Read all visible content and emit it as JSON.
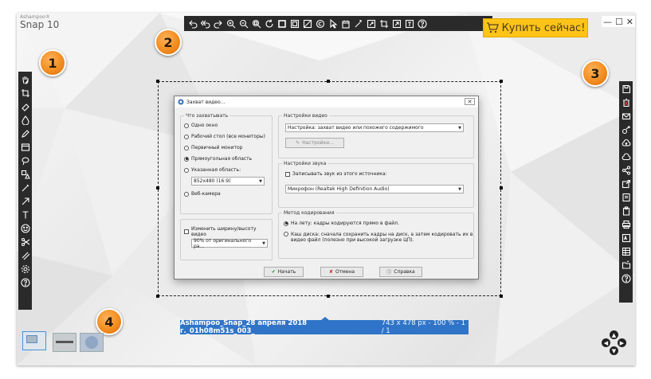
{
  "app": {
    "brand_small": "Ashampoo®",
    "brand_name": "Snap 10"
  },
  "top_toolbar": {
    "icons": [
      "undo-icon",
      "undo-all-icon",
      "redo-icon",
      "zoom-in-icon",
      "zoom-out-icon",
      "zoom-fit-icon",
      "rotate-icon",
      "crop-frame-icon",
      "border-icon",
      "color-icon",
      "copyright-icon",
      "pointer-icon",
      "calendar-icon",
      "magic-icon",
      "resize-icon",
      "crop-icon",
      "expand-icon",
      "text-frame-icon",
      "help-icon"
    ]
  },
  "buy_button": {
    "label": "Купить сейчас!"
  },
  "window_controls": {
    "minimize": "—",
    "maximize": "☐",
    "close": "✕"
  },
  "left_toolbar": {
    "icons": [
      "hand-icon",
      "crop-icon",
      "eraser-icon",
      "fill-drop-icon",
      "pencil-icon",
      "frame-icon",
      "lasso-icon",
      "shapes-icon",
      "pen-icon",
      "arrow-icon",
      "text-icon",
      "smiley-icon",
      "scissors-icon",
      "blur-icon",
      "settings-icon",
      "help-icon"
    ],
    "text_glyph": "T",
    "help_glyph": "?"
  },
  "right_toolbar": {
    "icons": [
      "save-icon",
      "delete-icon",
      "email-icon",
      "share-icon",
      "cloud-upload-icon",
      "cloud-icon",
      "network-share-icon",
      "export-icon",
      "pdf-icon",
      "clipboard-icon",
      "print-icon",
      "ocr-icon",
      "table-icon",
      "folder-open-icon",
      "help-icon"
    ],
    "help_glyph": "?"
  },
  "badges": [
    "1",
    "2",
    "3",
    "4"
  ],
  "dialog": {
    "title": "Захват видео...",
    "capture_group": {
      "label": "Что захватывать",
      "options": [
        "Одно окно",
        "Рабочий стол (все мониторы)",
        "Первичный монитор",
        "Прямоугольная область",
        "Указанная область:",
        "Веб-камера"
      ],
      "selected_index": 3,
      "area_value": "852x480 (16:9)"
    },
    "resize_group": {
      "checkbox_label": "Изменить ширину/высоту видео",
      "value": "90% от оригинального ра..."
    },
    "video_group": {
      "label": "Настройки видео",
      "value": "Настройка: захват видео или похожего содержимого",
      "button": "Настройки..."
    },
    "audio_group": {
      "label": "Настройки звука",
      "checkbox_label": "Записывать звук из этого источника:",
      "value": "Микрофон (Realtek High Definition Audio)"
    },
    "encode_group": {
      "label": "Метод кодирования",
      "option1": "На лету: кадры кодируются прямо в файл.",
      "option2_line1": "Каш диска: сначала сохранить кадры на диск, а затем кодировать их в",
      "option2_line2": "видео файл (полезно при высокой загрузке ЦП)."
    },
    "buttons": {
      "start": "Начать",
      "cancel": "Отмена",
      "help": "Справка"
    }
  },
  "info_bar": {
    "filename": "Ashampoo_Snap_28 апреля 2018 г._01h08m51s_003_",
    "dimensions": "743 x 478 px - 100 % - 1 / 1"
  },
  "colors": {
    "toolbar": "#2a2a2a",
    "buy_button": "#ffc418",
    "badge": "#f08a1c",
    "info_bar": "#2f74c8"
  }
}
